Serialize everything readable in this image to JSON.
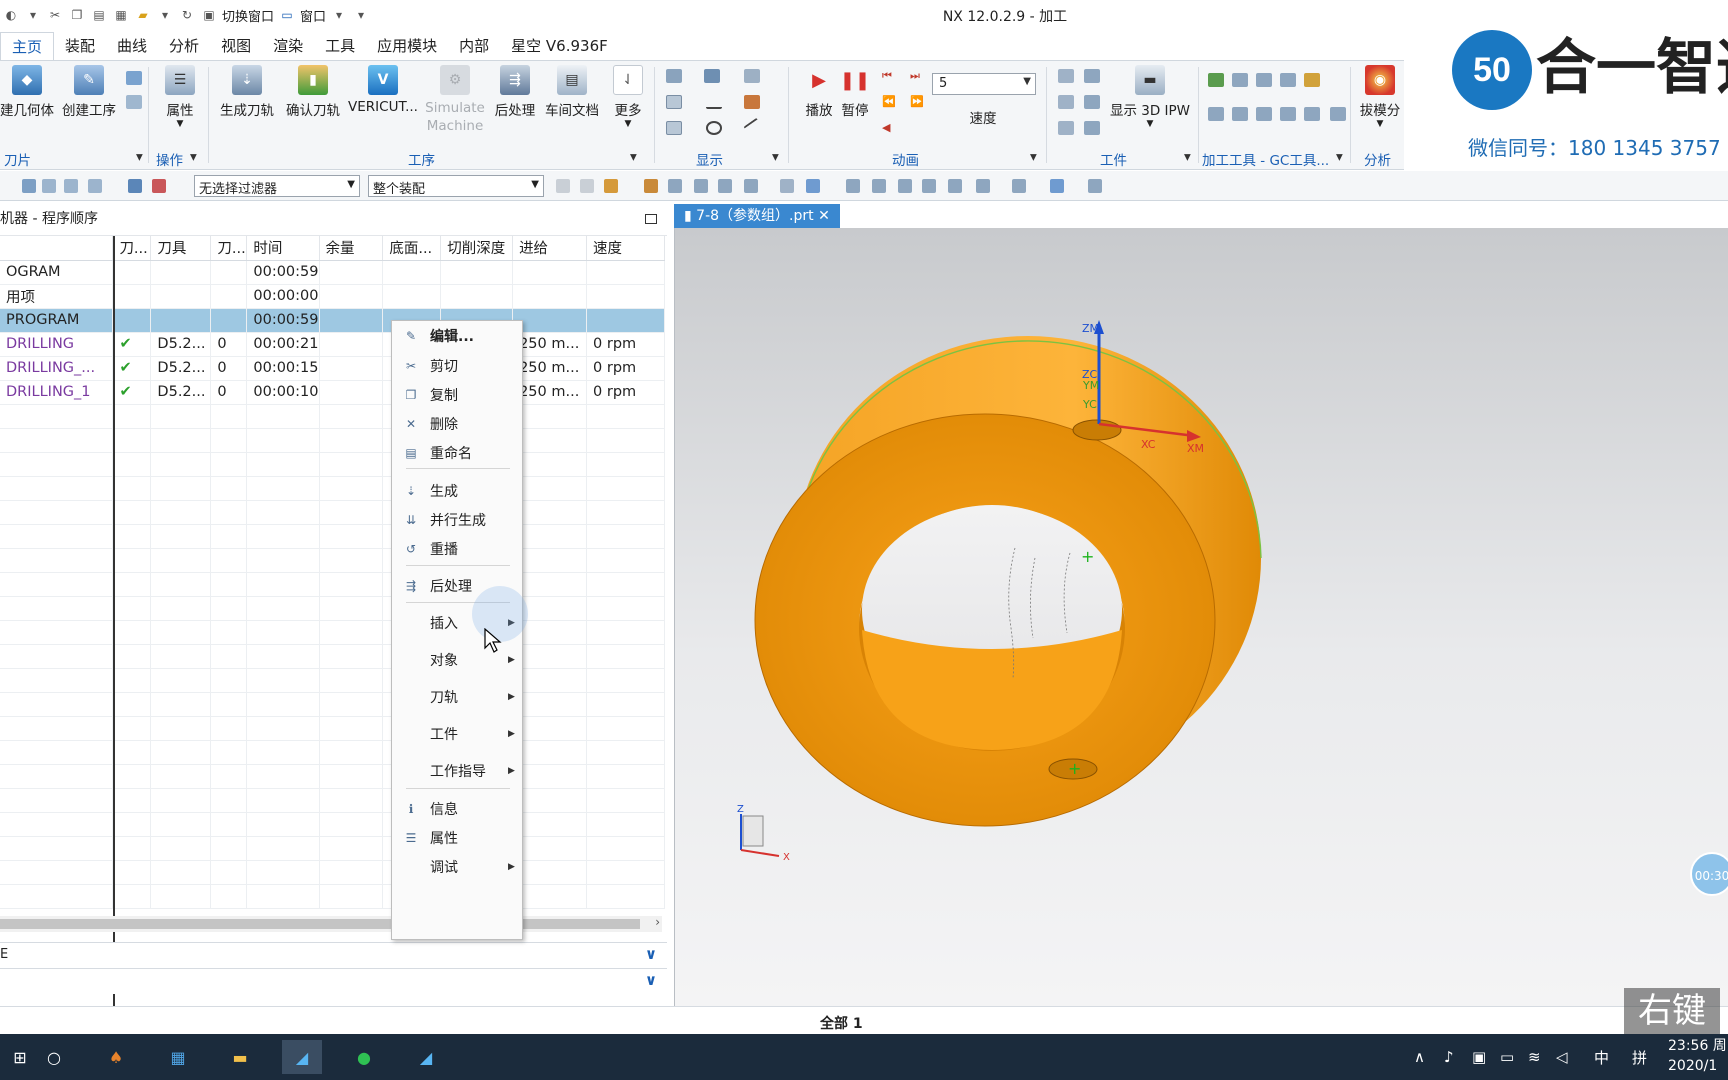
{
  "window": {
    "title": "NX 12.0.2.9 - 加工"
  },
  "quick_access": {
    "switch_window": "切换窗口",
    "window_menu": "窗口"
  },
  "ribbon": {
    "tabs": [
      "主页",
      "装配",
      "曲线",
      "分析",
      "视图",
      "渲染",
      "工具",
      "应用模块",
      "内部",
      "星空 V6.936F"
    ],
    "active_tab": "主页",
    "buttons": {
      "create_geometry": "建几何体",
      "create_operation": "创建工序",
      "properties": "属性",
      "generate_path": "生成刀轨",
      "verify_path": "确认刀轨",
      "vericut": "VERICUT...",
      "simulate_machine": "Simulate Machine",
      "post_process": "后处理",
      "shop_doc": "车间文档",
      "more": "更多",
      "play": "播放",
      "pause": "暂停",
      "speed": "速度",
      "show_3d_ipw": "显示 3D IPW",
      "draft_analysis": "拔模分"
    },
    "speed_value": "5",
    "groups": {
      "blade": "刀片",
      "operations": "操作",
      "process": "工序",
      "display": "显示",
      "animation": "动画",
      "workpiece": "工件",
      "machining_tools": "加工工具 - GC工具...",
      "analysis": "分析"
    }
  },
  "filter_bar": {
    "selection_filter": "无选择过滤器",
    "assembly_scope": "整个装配"
  },
  "brand": {
    "logo_mark": "50",
    "logo_text": "合一智造",
    "wechat": "微信同号：180 1345 3757"
  },
  "navigator": {
    "title": "机器 - 程序顺序",
    "columns": [
      "",
      "刀...",
      "刀具",
      "刀...",
      "时间",
      "余量",
      "底面...",
      "切削深度",
      "进给",
      "速度"
    ],
    "rows": [
      {
        "name": "OGRAM",
        "check": "",
        "tool": "",
        "tnum": "",
        "time": "00:00:59",
        "feed": "",
        "speed": ""
      },
      {
        "name": "用项",
        "check": "",
        "tool": "",
        "tnum": "",
        "time": "00:00:00",
        "feed": "",
        "speed": ""
      },
      {
        "name": "PROGRAM",
        "check": "",
        "tool": "",
        "tnum": "",
        "time": "00:00:59",
        "feed": "",
        "speed": ""
      },
      {
        "name": "DRILLING",
        "check": "✔",
        "tool": "D5.2...",
        "tnum": "0",
        "time": "00:00:21",
        "feed": "250 m...",
        "speed": "0 rpm"
      },
      {
        "name": "DRILLING_...",
        "check": "✔",
        "tool": "D5.2...",
        "tnum": "0",
        "time": "00:00:15",
        "feed": "250 m...",
        "speed": "0 rpm"
      },
      {
        "name": "DRILLING_1",
        "check": "✔",
        "tool": "D5.2...",
        "tnum": "0",
        "time": "00:00:10",
        "feed": "250 m...",
        "speed": "0 rpm"
      }
    ],
    "selected_row": 2,
    "pane_labels": [
      "E",
      ""
    ]
  },
  "context_menu": {
    "items": [
      {
        "label": "编辑...",
        "icon": "edit-icon",
        "submenu": false
      },
      {
        "label": "剪切",
        "icon": "cut-icon",
        "submenu": false
      },
      {
        "label": "复制",
        "icon": "copy-icon",
        "submenu": false
      },
      {
        "label": "删除",
        "icon": "delete-icon",
        "submenu": false
      },
      {
        "label": "重命名",
        "icon": "rename-icon",
        "submenu": false
      },
      {
        "label": "生成",
        "icon": "generate-icon",
        "submenu": false
      },
      {
        "label": "并行生成",
        "icon": "parallel-generate-icon",
        "submenu": false
      },
      {
        "label": "重播",
        "icon": "replay-icon",
        "submenu": false
      },
      {
        "label": "后处理",
        "icon": "postprocess-icon",
        "submenu": false
      },
      {
        "label": "插入",
        "icon": "",
        "submenu": true
      },
      {
        "label": "对象",
        "icon": "",
        "submenu": true
      },
      {
        "label": "刀轨",
        "icon": "",
        "submenu": true
      },
      {
        "label": "工件",
        "icon": "",
        "submenu": true
      },
      {
        "label": "工作指导",
        "icon": "",
        "submenu": true
      },
      {
        "label": "信息",
        "icon": "info-icon",
        "submenu": false
      },
      {
        "label": "属性",
        "icon": "properties-icon",
        "submenu": false
      },
      {
        "label": "调试",
        "icon": "",
        "submenu": true
      }
    ]
  },
  "viewport": {
    "tab_label": "7-8（参数组）.prt",
    "axis_labels": {
      "zm": "ZM",
      "zc": "ZC",
      "ym": "YM",
      "yc": "YC",
      "xc": "XC",
      "xm": "XM"
    },
    "triad_labels": {
      "z": "Z",
      "x": "X"
    },
    "part_color": "#f59a0c"
  },
  "status_bar": {
    "selection": "全部 1"
  },
  "overlay": {
    "watermark": "右键",
    "timer": "00:30"
  },
  "taskbar": {
    "tray": {
      "ime": "中",
      "ime2": "拼"
    },
    "clock_time": "23:56 周",
    "clock_date": "2020/1"
  }
}
